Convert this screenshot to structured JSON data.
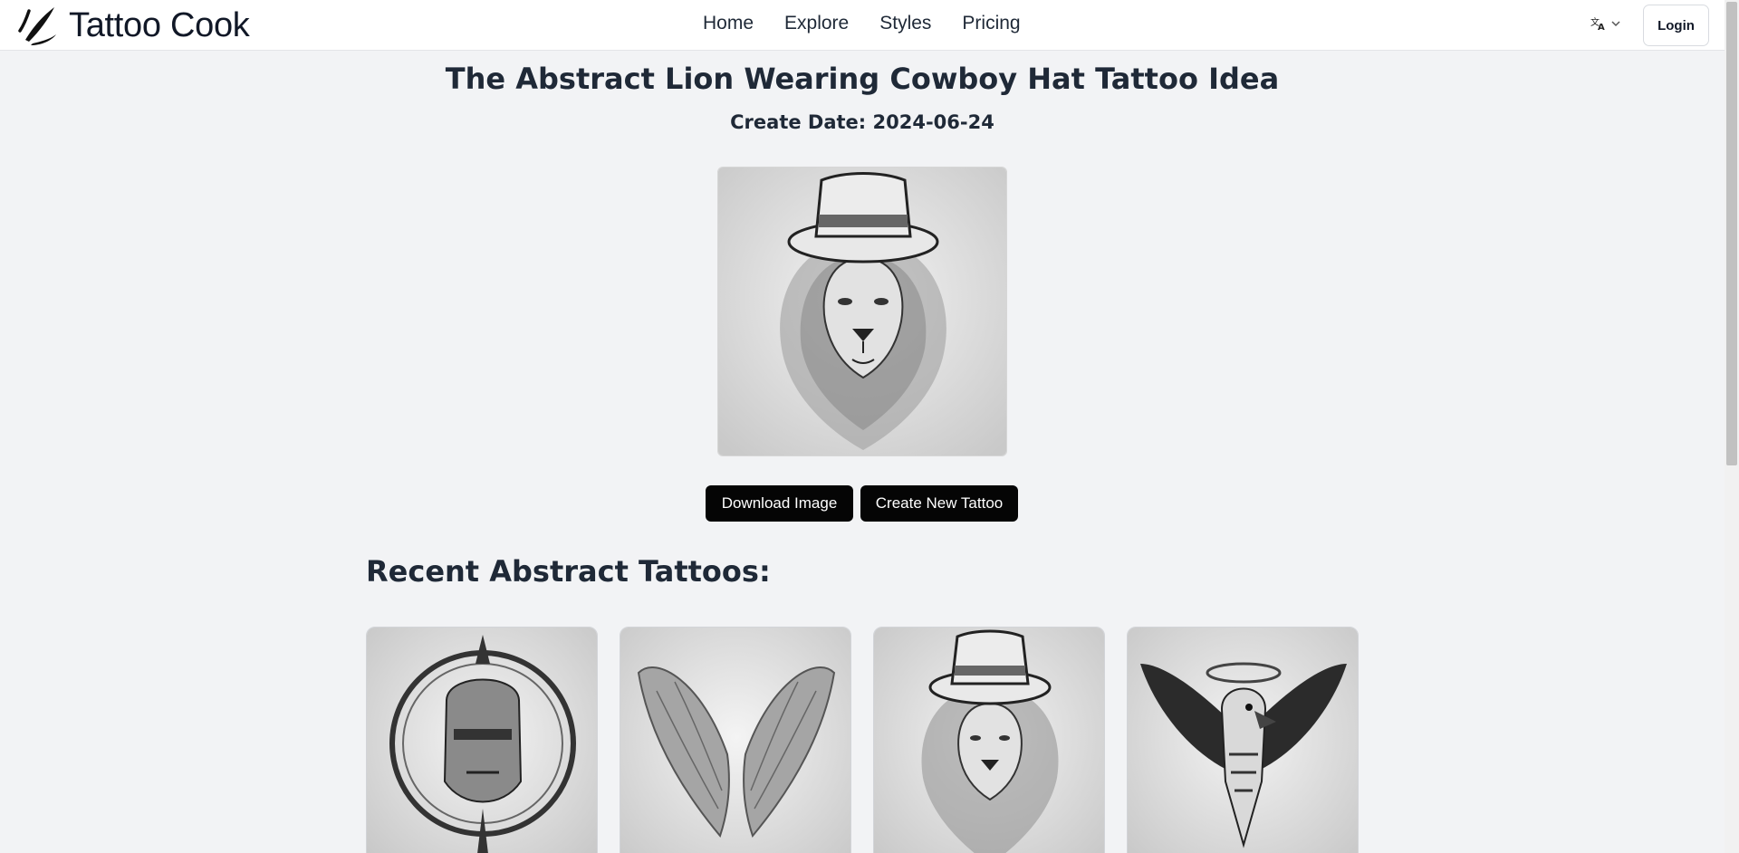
{
  "nav": {
    "logo_text": "Tattoo Cook",
    "links": [
      {
        "label": "Home"
      },
      {
        "label": "Explore"
      },
      {
        "label": "Styles"
      },
      {
        "label": "Pricing"
      }
    ],
    "language_icon": "translate-icon",
    "login_label": "Login"
  },
  "page": {
    "title": "The Abstract Lion Wearing Cowboy Hat Tattoo Idea",
    "date": "Create Date: 2024-06-24",
    "download_label": "Download Image",
    "create_label": "Create New Tattoo"
  },
  "recent": {
    "heading": "Recent Abstract Tattoos:",
    "cards": [
      {
        "subject": "warrior-medallion"
      },
      {
        "subject": "angel-wings"
      },
      {
        "subject": "lion-cowboy-hat"
      },
      {
        "subject": "eagle-crest"
      }
    ]
  },
  "colors": {
    "background": "#f2f3f5",
    "button": "#050505",
    "text": "#1f2937"
  }
}
